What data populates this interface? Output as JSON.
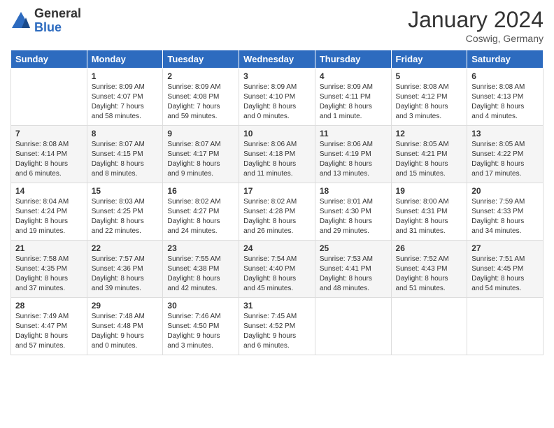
{
  "header": {
    "logo_general": "General",
    "logo_blue": "Blue",
    "month_title": "January 2024",
    "location": "Coswig, Germany"
  },
  "days_of_week": [
    "Sunday",
    "Monday",
    "Tuesday",
    "Wednesday",
    "Thursday",
    "Friday",
    "Saturday"
  ],
  "weeks": [
    [
      {
        "day": "",
        "info": ""
      },
      {
        "day": "1",
        "info": "Sunrise: 8:09 AM\nSunset: 4:07 PM\nDaylight: 7 hours\nand 58 minutes."
      },
      {
        "day": "2",
        "info": "Sunrise: 8:09 AM\nSunset: 4:08 PM\nDaylight: 7 hours\nand 59 minutes."
      },
      {
        "day": "3",
        "info": "Sunrise: 8:09 AM\nSunset: 4:10 PM\nDaylight: 8 hours\nand 0 minutes."
      },
      {
        "day": "4",
        "info": "Sunrise: 8:09 AM\nSunset: 4:11 PM\nDaylight: 8 hours\nand 1 minute."
      },
      {
        "day": "5",
        "info": "Sunrise: 8:08 AM\nSunset: 4:12 PM\nDaylight: 8 hours\nand 3 minutes."
      },
      {
        "day": "6",
        "info": "Sunrise: 8:08 AM\nSunset: 4:13 PM\nDaylight: 8 hours\nand 4 minutes."
      }
    ],
    [
      {
        "day": "7",
        "info": "Sunrise: 8:08 AM\nSunset: 4:14 PM\nDaylight: 8 hours\nand 6 minutes."
      },
      {
        "day": "8",
        "info": "Sunrise: 8:07 AM\nSunset: 4:15 PM\nDaylight: 8 hours\nand 8 minutes."
      },
      {
        "day": "9",
        "info": "Sunrise: 8:07 AM\nSunset: 4:17 PM\nDaylight: 8 hours\nand 9 minutes."
      },
      {
        "day": "10",
        "info": "Sunrise: 8:06 AM\nSunset: 4:18 PM\nDaylight: 8 hours\nand 11 minutes."
      },
      {
        "day": "11",
        "info": "Sunrise: 8:06 AM\nSunset: 4:19 PM\nDaylight: 8 hours\nand 13 minutes."
      },
      {
        "day": "12",
        "info": "Sunrise: 8:05 AM\nSunset: 4:21 PM\nDaylight: 8 hours\nand 15 minutes."
      },
      {
        "day": "13",
        "info": "Sunrise: 8:05 AM\nSunset: 4:22 PM\nDaylight: 8 hours\nand 17 minutes."
      }
    ],
    [
      {
        "day": "14",
        "info": "Sunrise: 8:04 AM\nSunset: 4:24 PM\nDaylight: 8 hours\nand 19 minutes."
      },
      {
        "day": "15",
        "info": "Sunrise: 8:03 AM\nSunset: 4:25 PM\nDaylight: 8 hours\nand 22 minutes."
      },
      {
        "day": "16",
        "info": "Sunrise: 8:02 AM\nSunset: 4:27 PM\nDaylight: 8 hours\nand 24 minutes."
      },
      {
        "day": "17",
        "info": "Sunrise: 8:02 AM\nSunset: 4:28 PM\nDaylight: 8 hours\nand 26 minutes."
      },
      {
        "day": "18",
        "info": "Sunrise: 8:01 AM\nSunset: 4:30 PM\nDaylight: 8 hours\nand 29 minutes."
      },
      {
        "day": "19",
        "info": "Sunrise: 8:00 AM\nSunset: 4:31 PM\nDaylight: 8 hours\nand 31 minutes."
      },
      {
        "day": "20",
        "info": "Sunrise: 7:59 AM\nSunset: 4:33 PM\nDaylight: 8 hours\nand 34 minutes."
      }
    ],
    [
      {
        "day": "21",
        "info": "Sunrise: 7:58 AM\nSunset: 4:35 PM\nDaylight: 8 hours\nand 37 minutes."
      },
      {
        "day": "22",
        "info": "Sunrise: 7:57 AM\nSunset: 4:36 PM\nDaylight: 8 hours\nand 39 minutes."
      },
      {
        "day": "23",
        "info": "Sunrise: 7:55 AM\nSunset: 4:38 PM\nDaylight: 8 hours\nand 42 minutes."
      },
      {
        "day": "24",
        "info": "Sunrise: 7:54 AM\nSunset: 4:40 PM\nDaylight: 8 hours\nand 45 minutes."
      },
      {
        "day": "25",
        "info": "Sunrise: 7:53 AM\nSunset: 4:41 PM\nDaylight: 8 hours\nand 48 minutes."
      },
      {
        "day": "26",
        "info": "Sunrise: 7:52 AM\nSunset: 4:43 PM\nDaylight: 8 hours\nand 51 minutes."
      },
      {
        "day": "27",
        "info": "Sunrise: 7:51 AM\nSunset: 4:45 PM\nDaylight: 8 hours\nand 54 minutes."
      }
    ],
    [
      {
        "day": "28",
        "info": "Sunrise: 7:49 AM\nSunset: 4:47 PM\nDaylight: 8 hours\nand 57 minutes."
      },
      {
        "day": "29",
        "info": "Sunrise: 7:48 AM\nSunset: 4:48 PM\nDaylight: 9 hours\nand 0 minutes."
      },
      {
        "day": "30",
        "info": "Sunrise: 7:46 AM\nSunset: 4:50 PM\nDaylight: 9 hours\nand 3 minutes."
      },
      {
        "day": "31",
        "info": "Sunrise: 7:45 AM\nSunset: 4:52 PM\nDaylight: 9 hours\nand 6 minutes."
      },
      {
        "day": "",
        "info": ""
      },
      {
        "day": "",
        "info": ""
      },
      {
        "day": "",
        "info": ""
      }
    ]
  ]
}
